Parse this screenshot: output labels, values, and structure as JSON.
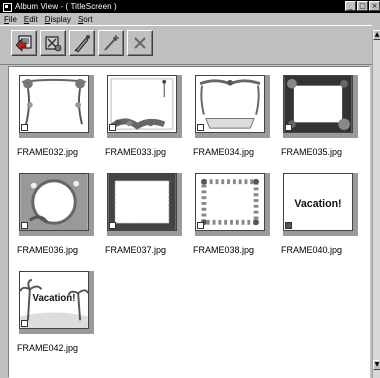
{
  "window": {
    "title": "Album View - ( TitleScreen )",
    "min_label": "_",
    "max_label": "□",
    "close_label": "×"
  },
  "menu": [
    {
      "label": "File",
      "ul": "F",
      "rest": "ile"
    },
    {
      "label": "Edit",
      "ul": "E",
      "rest": "dit"
    },
    {
      "label": "Display",
      "ul": "D",
      "rest": "isplay"
    },
    {
      "label": "Sort",
      "ul": "S",
      "rest": "ort"
    }
  ],
  "toolbar": {
    "buttons": [
      {
        "name": "import-button",
        "icon": "import-icon"
      },
      {
        "name": "settings-button",
        "icon": "settings-icon"
      },
      {
        "name": "pen-button",
        "icon": "pen-icon"
      },
      {
        "name": "wand-button",
        "icon": "wand-icon"
      },
      {
        "name": "delete-button",
        "icon": "x-icon"
      }
    ]
  },
  "thumbnails": [
    {
      "filename": "FRAME032.jpg",
      "style": "ribbon-hang"
    },
    {
      "filename": "FRAME033.jpg",
      "style": "flower-bottom"
    },
    {
      "filename": "FRAME034.jpg",
      "style": "ribbon-banner"
    },
    {
      "filename": "FRAME035.jpg",
      "style": "dark-roses"
    },
    {
      "filename": "FRAME036.jpg",
      "style": "circle-leaves"
    },
    {
      "filename": "FRAME037.jpg",
      "style": "dark-border"
    },
    {
      "filename": "FRAME038.jpg",
      "style": "flower-ring"
    },
    {
      "filename": "FRAME040.jpg",
      "style": "vacation-text",
      "text": "Vacation!"
    },
    {
      "filename": "FRAME042.jpg",
      "style": "vacation-palms",
      "text": "Vacation!"
    }
  ],
  "scrollbar": {
    "up": "▲",
    "down": "▼"
  }
}
